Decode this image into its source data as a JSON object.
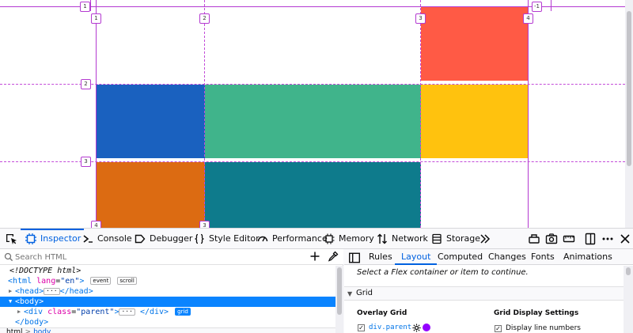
{
  "grid": {
    "cells": [
      {
        "name": "cell-red",
        "color": "#ff5a45"
      },
      {
        "name": "cell-blue",
        "color": "#1a61bf"
      },
      {
        "name": "cell-green",
        "color": "#40b48b"
      },
      {
        "name": "cell-yellow",
        "color": "#ffc20e"
      },
      {
        "name": "cell-orange",
        "color": "#dc6b12"
      },
      {
        "name": "cell-teal",
        "color": "#0e7b8c"
      }
    ],
    "line_color": "#c34bd9",
    "line_numbers": {
      "top_left": "1",
      "top_right": "-1",
      "columns": [
        "1",
        "2",
        "3",
        "4"
      ],
      "rows": [
        "2",
        "3"
      ],
      "bottom": [
        "4",
        "3"
      ]
    }
  },
  "toolbar": {
    "tabs": [
      {
        "label": "Inspector",
        "icon": "inspector-icon",
        "active": true
      },
      {
        "label": "Console",
        "icon": "console-icon",
        "active": false
      },
      {
        "label": "Debugger",
        "icon": "debugger-icon",
        "active": false
      },
      {
        "label": "Style Editor",
        "icon": "style-editor-icon",
        "active": false
      },
      {
        "label": "Performance",
        "icon": "performance-icon",
        "active": false
      },
      {
        "label": "Memory",
        "icon": "memory-icon",
        "active": false
      },
      {
        "label": "Network",
        "icon": "network-icon",
        "active": false
      },
      {
        "label": "Storage",
        "icon": "storage-icon",
        "active": false
      }
    ],
    "more_icon": "chevron-double-right-icon"
  },
  "markup": {
    "search_placeholder": "Search HTML",
    "rows": {
      "doctype": "<!DOCTYPE html>",
      "html_open": "<html",
      "html_attr_name": "lang",
      "html_attr_value": "\"en\"",
      "html_close": ">",
      "badge_event": "event",
      "badge_scroll": "scroll",
      "head": "<head>",
      "head_close": "</head>",
      "body_open": "<body>",
      "div_open": "<div",
      "div_attr_name": "class",
      "div_attr_value": "\"parent\"",
      "div_gt": ">",
      "div_close": "</div>",
      "badge_grid": "grid",
      "body_close": "</body>"
    },
    "breadcrumbs": [
      "html",
      "body"
    ]
  },
  "sidebar": {
    "tabs": [
      "Rules",
      "Layout",
      "Computed",
      "Changes",
      "Fonts",
      "Animations"
    ],
    "active_tab": "Layout",
    "flex_message": "Select a Flex container or item to continue.",
    "grid_section": "Grid",
    "overlay_grid_title": "Overlay Grid",
    "overlay_item": "div.parent",
    "overlay_color": "#9400ff",
    "display_settings_title": "Grid Display Settings",
    "display_line_numbers": "Display line numbers"
  }
}
